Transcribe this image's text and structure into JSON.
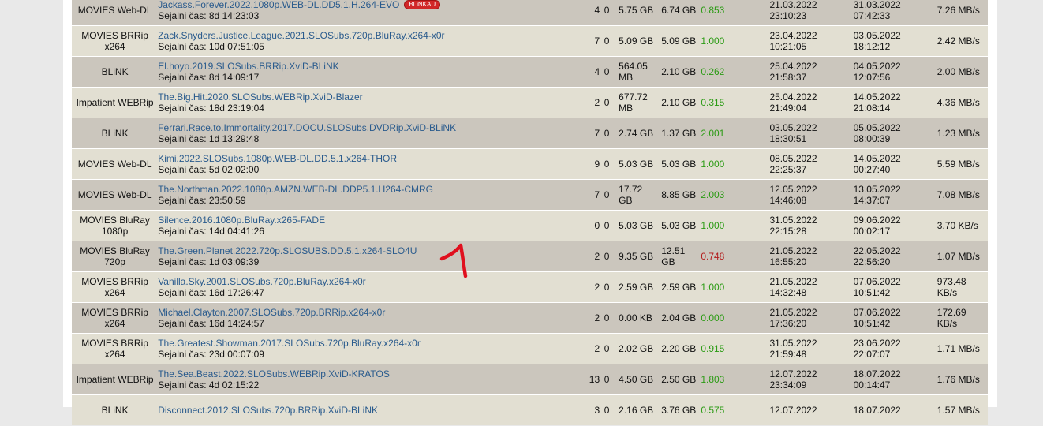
{
  "colors": {
    "link": "#2a5b8d",
    "row_dark": "#cbc6bd",
    "row_light": "#e2dfd2",
    "ratio_good": "#2b9b14",
    "ratio_bad": "#b31b1b",
    "badge": "#d12828"
  },
  "rows": [
    {
      "category": "MOVIES Web-DL",
      "name": "Jackass.Forever.2022.1080p.WEB-DL.DD5.1.H.264-EVO",
      "badge": "BLiNKAU",
      "seed_time": "Sejalni čas: 8d 14:23:03",
      "seeders": "4",
      "leechers": "0",
      "downloaded": "5.75 GB",
      "size": "6.74 GB",
      "ratio": "0.853",
      "added": "21.03.2022 23:10:23",
      "completed": "31.03.2022 07:42:33",
      "speed": "7.26 MB/s"
    },
    {
      "category": "MOVIES BRRip x264",
      "name": "Zack.Snyders.Justice.League.2021.SLOSubs.720p.BluRay.x264-x0r",
      "seed_time": "Sejalni čas: 10d 07:51:05",
      "seeders": "7",
      "leechers": "0",
      "downloaded": "5.09 GB",
      "size": "5.09 GB",
      "ratio": "1.000",
      "added": "23.04.2022 10:21:05",
      "completed": "03.05.2022 18:12:12",
      "speed": "2.42 MB/s"
    },
    {
      "category": "BLiNK",
      "name": "El.hoyo.2019.SLOSubs.BRRip.XviD-BLiNK",
      "seed_time": "Sejalni čas: 8d 14:09:17",
      "seeders": "4",
      "leechers": "0",
      "downloaded": "564.05 MB",
      "size": "2.10 GB",
      "ratio": "0.262",
      "added": "25.04.2022 21:58:37",
      "completed": "04.05.2022 12:07:56",
      "speed": "2.00 MB/s"
    },
    {
      "category": "Impatient WEBRip",
      "name": "The.Big.Hit.2020.SLOSubs.WEBRip.XviD-Blazer",
      "seed_time": "Sejalni čas: 18d 23:19:04",
      "seeders": "2",
      "leechers": "0",
      "downloaded": "677.72 MB",
      "size": "2.10 GB",
      "ratio": "0.315",
      "added": "25.04.2022 21:49:04",
      "completed": "14.05.2022 21:08:14",
      "speed": "4.36 MB/s"
    },
    {
      "category": "BLiNK",
      "name": "Ferrari.Race.to.Immortality.2017.DOCU.SLOSubs.DVDRip.XviD-BLiNK",
      "seed_time": "Sejalni čas: 1d 13:29:48",
      "seeders": "7",
      "leechers": "0",
      "downloaded": "2.74 GB",
      "size": "1.37 GB",
      "ratio": "2.001",
      "added": "03.05.2022 18:30:51",
      "completed": "05.05.2022 08:00:39",
      "speed": "1.23 MB/s"
    },
    {
      "category": "MOVIES Web-DL",
      "name": "Kimi.2022.SLOSubs.1080p.WEB-DL.DD.5.1.x264-THOR",
      "seed_time": "Sejalni čas: 5d 02:02:00",
      "seeders": "9",
      "leechers": "0",
      "downloaded": "5.03 GB",
      "size": "5.03 GB",
      "ratio": "1.000",
      "added": "08.05.2022 22:25:37",
      "completed": "14.05.2022 00:27:40",
      "speed": "5.59 MB/s"
    },
    {
      "category": "MOVIES Web-DL",
      "name": "The.Northman.2022.1080p.AMZN.WEB-DL.DDP5.1.H264-CMRG",
      "seed_time": "Sejalni čas: 23:50:59",
      "seeders": "7",
      "leechers": "0",
      "downloaded": "17.72 GB",
      "size": "8.85 GB",
      "ratio": "2.003",
      "added": "12.05.2022 14:46:08",
      "completed": "13.05.2022 14:37:07",
      "speed": "7.08 MB/s"
    },
    {
      "category": "MOVIES BluRay 1080p",
      "name": "Silence.2016.1080p.BluRay.x265-FADE",
      "seed_time": "Sejalni čas: 14d 04:41:26",
      "seeders": "0",
      "leechers": "0",
      "downloaded": "5.03 GB",
      "size": "5.03 GB",
      "ratio": "1.000",
      "added": "31.05.2022 22:15:28",
      "completed": "09.06.2022 00:02:17",
      "speed": "3.70 KB/s"
    },
    {
      "category": "MOVIES BluRay 720p",
      "name": "The.Green.Planet.2022.720p.SLOSUBS.DD.5.1.x264-SLO4U",
      "seed_time": "Sejalni čas: 1d 03:09:39",
      "seeders": "2",
      "leechers": "0",
      "downloaded": "9.35 GB",
      "size": "12.51 GB",
      "ratio": "0.748",
      "added": "21.05.2022 16:55:20",
      "completed": "22.05.2022 22:56:20",
      "speed": "1.07 MB/s"
    },
    {
      "category": "MOVIES BRRip x264",
      "name": "Vanilla.Sky.2001.SLOSubs.720p.BluRay.x264-x0r",
      "seed_time": "Sejalni čas: 16d 17:26:47",
      "seeders": "2",
      "leechers": "0",
      "downloaded": "2.59 GB",
      "size": "2.59 GB",
      "ratio": "1.000",
      "added": "21.05.2022 14:32:48",
      "completed": "07.06.2022 10:51:42",
      "speed": "973.48 KB/s"
    },
    {
      "category": "MOVIES BRRip x264",
      "name": "Michael.Clayton.2007.SLOSubs.720p.BRRip.x264-x0r",
      "seed_time": "Sejalni čas: 16d 14:24:57",
      "seeders": "2",
      "leechers": "0",
      "downloaded": "0.00 KB",
      "size": "2.04 GB",
      "ratio": "0.000",
      "added": "21.05.2022 17:36:20",
      "completed": "07.06.2022 10:51:42",
      "speed": "172.69 KB/s"
    },
    {
      "category": "MOVIES BRRip x264",
      "name": "The.Greatest.Showman.2017.SLOSubs.720p.BluRay.x264-x0r",
      "seed_time": "Sejalni čas: 23d 00:07:09",
      "seeders": "2",
      "leechers": "0",
      "downloaded": "2.02 GB",
      "size": "2.20 GB",
      "ratio": "0.915",
      "added": "31.05.2022 21:59:48",
      "completed": "23.06.2022 22:07:07",
      "speed": "1.71 MB/s"
    },
    {
      "category": "Impatient WEBRip",
      "name": "The.Sea.Beast.2022.SLOSubs.WEBRip.XviD-KRATOS",
      "seed_time": "Sejalni čas: 4d 02:15:22",
      "seeders": "13",
      "leechers": "0",
      "downloaded": "4.50 GB",
      "size": "2.50 GB",
      "ratio": "1.803",
      "added": "12.07.2022 23:34:09",
      "completed": "18.07.2022 00:14:47",
      "speed": "1.76 MB/s"
    },
    {
      "category": "BLiNK",
      "name": "Disconnect.2012.SLOSubs.720p.BRRip.XviD-BLiNK",
      "seed_time": "",
      "seeders": "3",
      "leechers": "0",
      "downloaded": "2.16 GB",
      "size": "3.76 GB",
      "ratio": "0.575",
      "added": "12.07.2022",
      "completed": "18.07.2022",
      "speed": "1.57 MB/s"
    }
  ],
  "annotation": {
    "text": "1"
  }
}
